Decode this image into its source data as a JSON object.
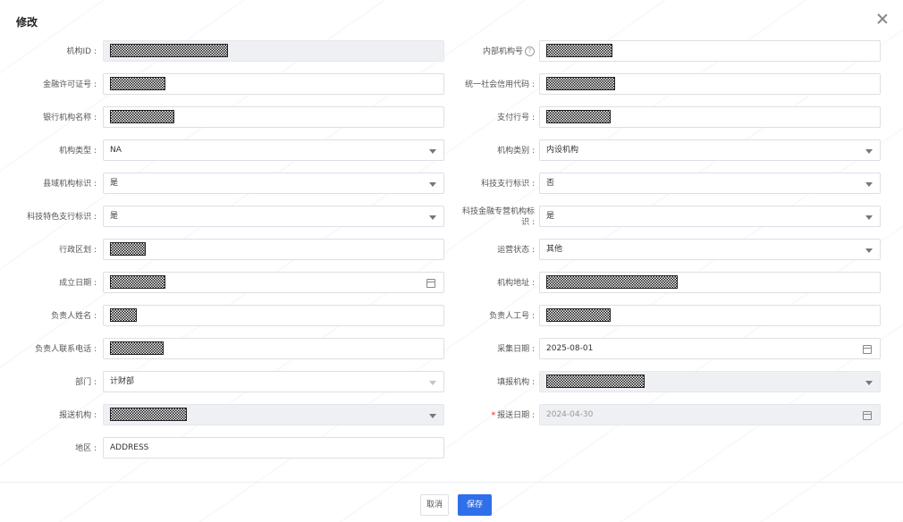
{
  "dialog": {
    "title": "修改",
    "cancel_label": "取消",
    "save_label": "保存"
  },
  "left": [
    {
      "label": "机构ID :",
      "value": "",
      "masked": true,
      "kind": "input",
      "disabled": true
    },
    {
      "label": "金融许可证号 :",
      "value": "",
      "masked": true,
      "kind": "input"
    },
    {
      "label": "银行机构名称 :",
      "value": "",
      "masked": true,
      "kind": "input"
    },
    {
      "label": "机构类型 :",
      "value": "NA",
      "kind": "select"
    },
    {
      "label": "县域机构标识 :",
      "value": "是",
      "kind": "select"
    },
    {
      "label": "科技特色支行标识 :",
      "value": "是",
      "kind": "select"
    },
    {
      "label": "行政区划 :",
      "value": "",
      "masked": true,
      "kind": "input"
    },
    {
      "label": "成立日期 :",
      "value": "",
      "masked": true,
      "kind": "date"
    },
    {
      "label": "负责人姓名 :",
      "value": "",
      "masked": true,
      "kind": "input"
    },
    {
      "label": "负责人联系电话 :",
      "value": "",
      "masked": true,
      "kind": "input"
    },
    {
      "label": "部门 :",
      "value": "计财部",
      "kind": "select-light"
    },
    {
      "label": "报送机构 :",
      "value": "",
      "masked": true,
      "kind": "select",
      "disabled": true
    },
    {
      "label": "地区 :",
      "value": "ADDRESS",
      "kind": "input"
    }
  ],
  "right": [
    {
      "label": "内部机构号",
      "help": "?",
      "value": "",
      "masked": true,
      "kind": "input"
    },
    {
      "label": "统一社会信用代码 :",
      "value": "",
      "masked": true,
      "kind": "input"
    },
    {
      "label": "支付行号 :",
      "value": "",
      "masked": true,
      "kind": "input"
    },
    {
      "label": "机构类别 :",
      "value": "内设机构",
      "kind": "select"
    },
    {
      "label": "科技支行标识 :",
      "value": "否",
      "kind": "select"
    },
    {
      "label": "科技金融专营机构标识 :",
      "value": "是",
      "kind": "select"
    },
    {
      "label": "运营状态 :",
      "value": "其他",
      "kind": "select"
    },
    {
      "label": "机构地址 :",
      "value": "",
      "masked": true,
      "kind": "input"
    },
    {
      "label": "负责人工号 :",
      "value": "",
      "masked": true,
      "kind": "input"
    },
    {
      "label": "采集日期 :",
      "value": "2025-08-01",
      "kind": "date"
    },
    {
      "label": "填报机构 :",
      "value": "",
      "masked": true,
      "kind": "select",
      "disabled": true
    },
    {
      "label": "报送日期 :",
      "value": "2024-04-30",
      "kind": "date",
      "disabled": true,
      "required": true
    }
  ]
}
